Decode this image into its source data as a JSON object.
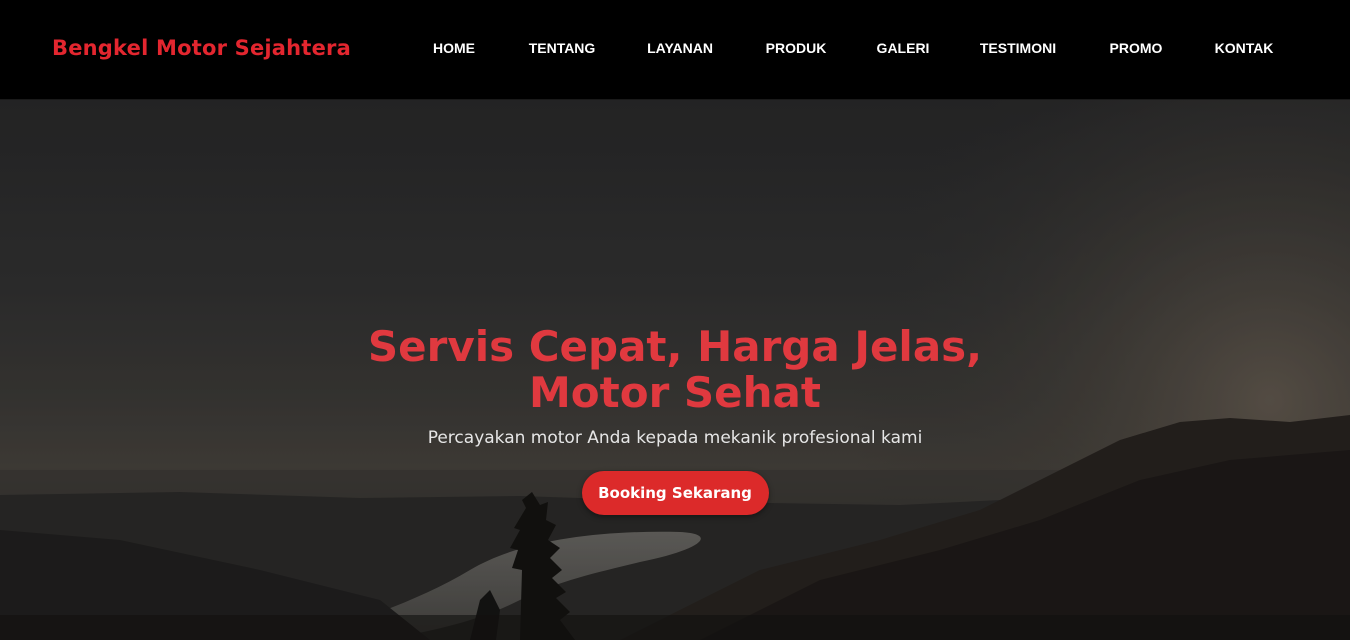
{
  "brand": {
    "name": "Bengkel Motor Sejahtera",
    "color": "#e3262f"
  },
  "nav": {
    "items": [
      {
        "label": "HOME"
      },
      {
        "label": "TENTANG"
      },
      {
        "label": "LAYANAN"
      },
      {
        "label": "PRODUK"
      },
      {
        "label": "GALERI"
      },
      {
        "label": "TESTIMONI"
      },
      {
        "label": "PROMO"
      },
      {
        "label": "KONTAK"
      }
    ]
  },
  "hero": {
    "title": "Servis Cepat, Harga Jelas, Motor Sehat",
    "subtitle": "Percayakan motor Anda kepada mekanik profesional kami",
    "cta_label": "Booking Sekarang",
    "background": "landscape-photo"
  },
  "colors": {
    "accent": "#dc2a2a",
    "navbar_bg": "#000000",
    "title_red": "#e0393f"
  }
}
